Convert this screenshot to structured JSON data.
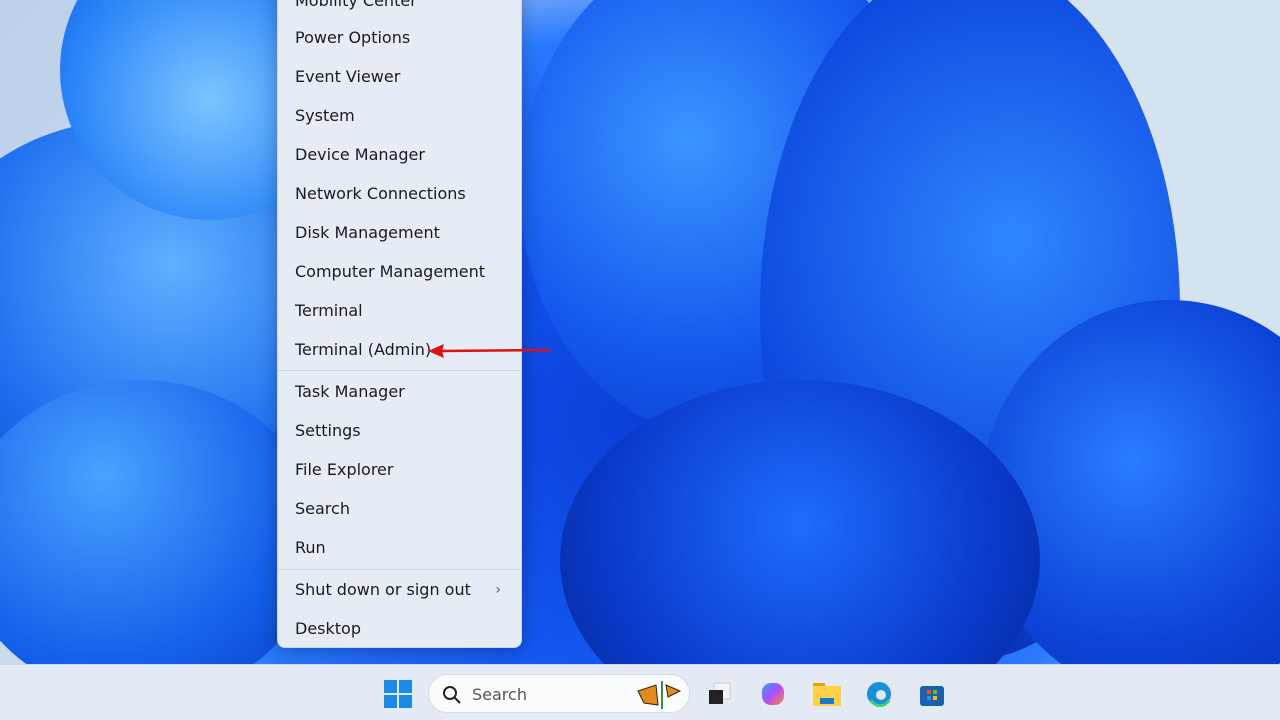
{
  "menu": {
    "items": [
      {
        "label": "Mobility Center"
      },
      {
        "label": "Power Options"
      },
      {
        "label": "Event Viewer"
      },
      {
        "label": "System"
      },
      {
        "label": "Device Manager"
      },
      {
        "label": "Network Connections"
      },
      {
        "label": "Disk Management"
      },
      {
        "label": "Computer Management"
      },
      {
        "label": "Terminal"
      },
      {
        "label": "Terminal (Admin)"
      },
      {
        "label": "Task Manager"
      },
      {
        "label": "Settings"
      },
      {
        "label": "File Explorer"
      },
      {
        "label": "Search"
      },
      {
        "label": "Run"
      },
      {
        "label": "Shut down or sign out",
        "submenu": true
      },
      {
        "label": "Desktop"
      }
    ]
  },
  "annotation": {
    "arrow_color": "#e01010",
    "target": "Terminal (Admin)"
  },
  "taskbar": {
    "search_placeholder": "Search",
    "icons": [
      "windows-start-icon",
      "task-view-icon",
      "copilot-icon",
      "file-explorer-icon",
      "edge-icon",
      "store-icon"
    ]
  }
}
